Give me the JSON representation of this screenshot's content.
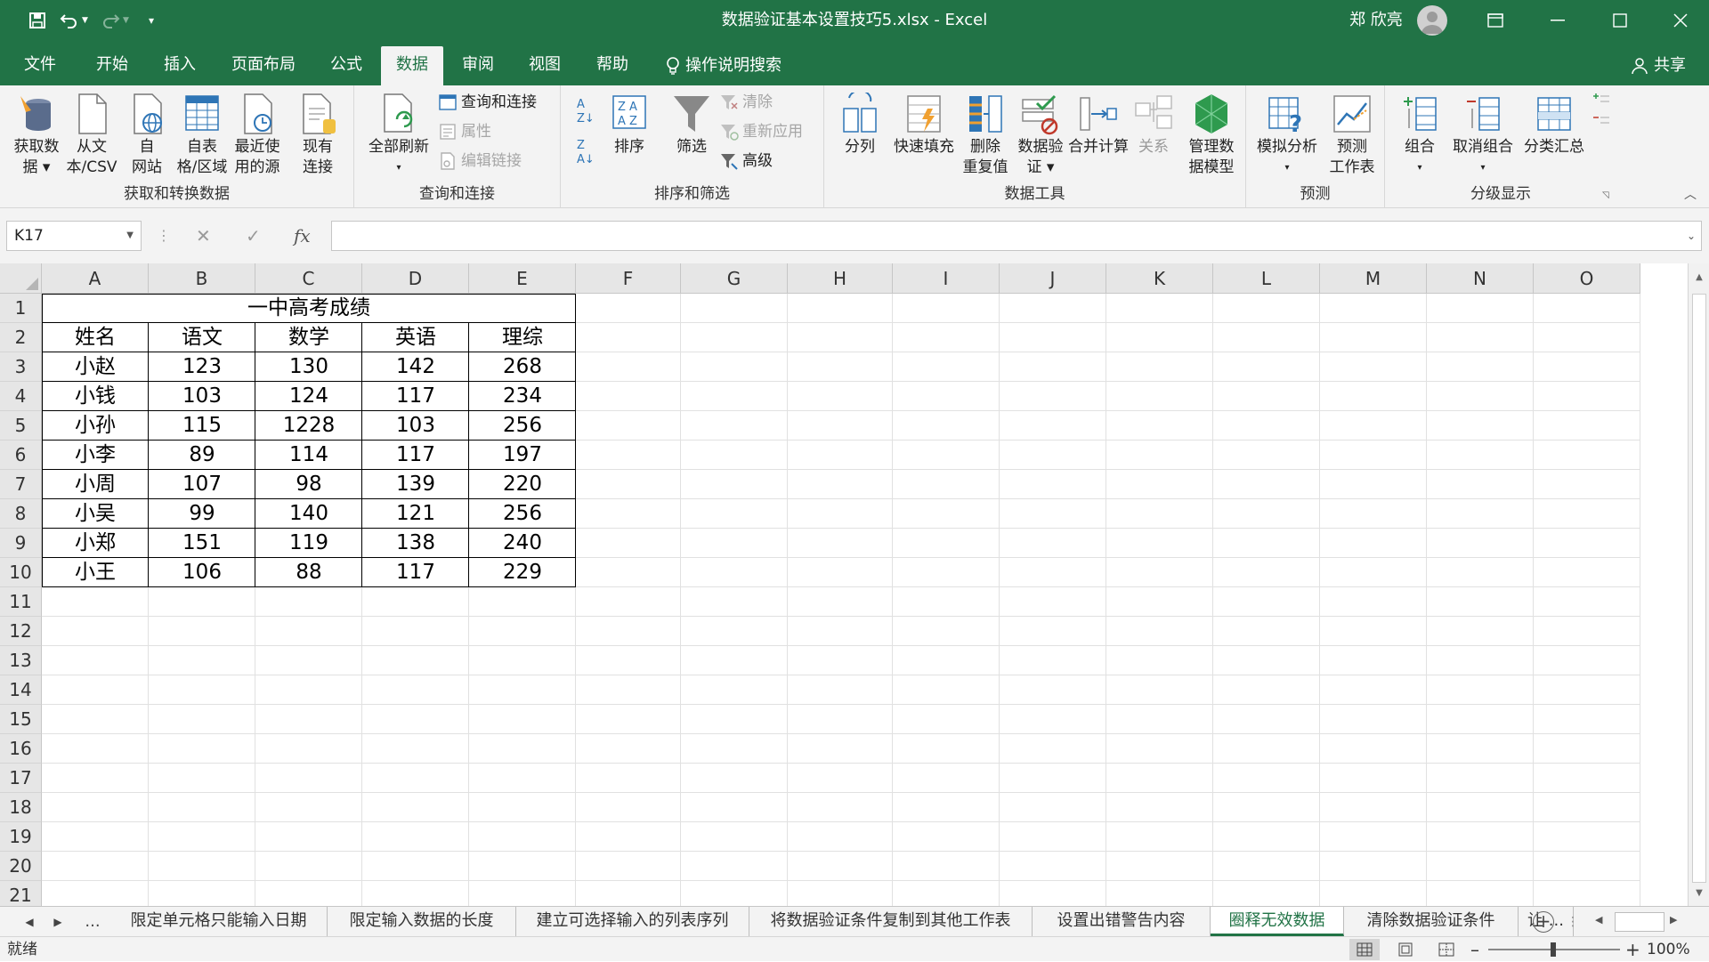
{
  "window": {
    "title": "数据验证基本设置技巧5.xlsx  -  Excel",
    "user": "郑 欣亮"
  },
  "menu": {
    "tabs": [
      {
        "label": "文件",
        "active": false
      },
      {
        "label": "开始",
        "active": false
      },
      {
        "label": "插入",
        "active": false
      },
      {
        "label": "页面布局",
        "active": false
      },
      {
        "label": "公式",
        "active": false
      },
      {
        "label": "数据",
        "active": true
      },
      {
        "label": "审阅",
        "active": false
      },
      {
        "label": "视图",
        "active": false
      },
      {
        "label": "帮助",
        "active": false
      },
      {
        "label": "操作说明搜索",
        "active": false
      }
    ],
    "share": "共享"
  },
  "ribbon": {
    "get_data": {
      "label": "获取和转换数据",
      "buttons": [
        {
          "l1": "获取数",
          "l2": "据 ▾"
        },
        {
          "l1": "从文",
          "l2": "本/CSV"
        },
        {
          "l1": "自",
          "l2": "网站"
        },
        {
          "l1": "自表",
          "l2": "格/区域"
        },
        {
          "l1": "最近使",
          "l2": "用的源"
        },
        {
          "l1": "现有",
          "l2": "连接"
        }
      ]
    },
    "queries": {
      "label": "查询和连接",
      "refresh_l1": "全部刷新",
      "refresh_l2": "▾",
      "small": [
        "查询和连接",
        "属性",
        "编辑链接"
      ]
    },
    "sort_filter": {
      "label": "排序和筛选",
      "sort": "排序",
      "filter": "筛选",
      "small": [
        "清除",
        "重新应用",
        "高级"
      ]
    },
    "data_tools": {
      "label": "数据工具",
      "buttons": [
        {
          "l1": "分列",
          "l2": ""
        },
        {
          "l1": "快速填充",
          "l2": ""
        },
        {
          "l1": "删除",
          "l2": "重复值"
        },
        {
          "l1": "数据验",
          "l2": "证 ▾"
        },
        {
          "l1": "合并计算",
          "l2": ""
        },
        {
          "l1": "关系",
          "l2": ""
        },
        {
          "l1": "管理数",
          "l2": "据模型"
        }
      ]
    },
    "forecast": {
      "label": "预测",
      "buttons": [
        {
          "l1": "模拟分析",
          "l2": "▾"
        },
        {
          "l1": "预测",
          "l2": "工作表"
        }
      ]
    },
    "outline": {
      "label": "分级显示",
      "buttons": [
        {
          "l1": "组合",
          "l2": "▾"
        },
        {
          "l1": "取消组合",
          "l2": "▾"
        },
        {
          "l1": "分类汇总",
          "l2": ""
        }
      ]
    }
  },
  "formula_bar": {
    "name_box": "K17",
    "fx": "fx",
    "formula": ""
  },
  "sheet": {
    "columns": [
      "A",
      "B",
      "C",
      "D",
      "E",
      "F",
      "G",
      "H",
      "I",
      "J",
      "K",
      "L",
      "M",
      "N",
      "O"
    ],
    "rows": [
      "1",
      "2",
      "3",
      "4",
      "5",
      "6",
      "7",
      "8",
      "9",
      "10",
      "11",
      "12",
      "13",
      "14",
      "15",
      "16",
      "17",
      "18",
      "19",
      "20",
      "21"
    ],
    "title": "一中高考成绩",
    "headers": [
      "姓名",
      "语文",
      "数学",
      "英语",
      "理综"
    ],
    "data": [
      [
        "小赵",
        "123",
        "130",
        "142",
        "268"
      ],
      [
        "小钱",
        "103",
        "124",
        "117",
        "234"
      ],
      [
        "小孙",
        "115",
        "1228",
        "103",
        "256"
      ],
      [
        "小李",
        "89",
        "114",
        "117",
        "197"
      ],
      [
        "小周",
        "107",
        "98",
        "139",
        "220"
      ],
      [
        "小吴",
        "99",
        "140",
        "121",
        "256"
      ],
      [
        "小郑",
        "151",
        "119",
        "138",
        "240"
      ],
      [
        "小王",
        "106",
        "88",
        "117",
        "229"
      ]
    ]
  },
  "sheet_tabs": {
    "overflow": "...",
    "tabs": [
      {
        "label": "限定单元格只能输入日期",
        "active": false
      },
      {
        "label": "限定输入数据的长度",
        "active": false
      },
      {
        "label": "建立可选择输入的列表序列",
        "active": false
      },
      {
        "label": "将数据验证条件复制到其他工作表",
        "active": false
      },
      {
        "label": "设置出错警告内容",
        "active": false
      },
      {
        "label": "圈释无效数据",
        "active": true
      },
      {
        "label": "清除数据验证条件",
        "active": false
      },
      {
        "label": "让 ...",
        "active": false
      }
    ]
  },
  "status": {
    "text": "就绪",
    "zoom": "100%"
  },
  "colors": {
    "accent": "#217346",
    "grid": "#e1e1e1"
  }
}
